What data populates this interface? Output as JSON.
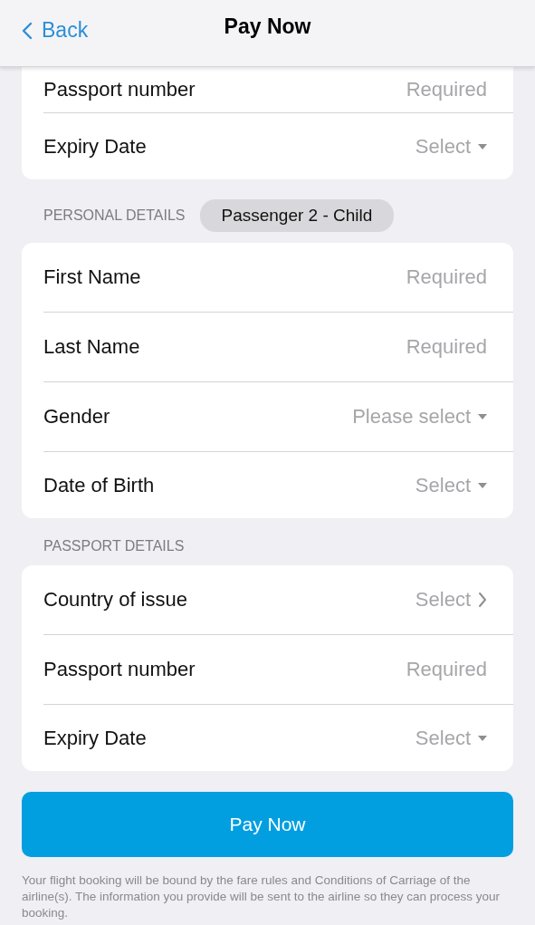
{
  "nav": {
    "back": "Back",
    "title": "Pay Now"
  },
  "sections": [
    {
      "rows": [
        {
          "kind": "input",
          "label": "Passport number",
          "placeholder": "Required"
        },
        {
          "kind": "select",
          "label": "Expiry Date",
          "value": "Select"
        }
      ]
    },
    {
      "heading": "PERSONAL DETAILS",
      "badge": "Passenger 2 - Child",
      "rows": [
        {
          "kind": "input",
          "label": "First Name",
          "placeholder": "Required"
        },
        {
          "kind": "input",
          "label": "Last Name",
          "placeholder": "Required"
        },
        {
          "kind": "select",
          "label": "Gender",
          "value": "Please select"
        },
        {
          "kind": "select",
          "label": "Date of Birth",
          "value": "Select"
        }
      ]
    },
    {
      "heading": "PASSPORT DETAILS",
      "rows": [
        {
          "kind": "picker",
          "label": "Country of issue",
          "value": "Select"
        },
        {
          "kind": "input",
          "label": "Passport number",
          "placeholder": "Required"
        },
        {
          "kind": "select",
          "label": "Expiry Date",
          "value": "Select"
        }
      ]
    }
  ],
  "pay_button": "Pay Now",
  "disclaimer": "Your flight booking will be bound by the fare rules and Conditions of Carriage of the airline(s). The information you provide will be sent to the airline so they can process your booking."
}
